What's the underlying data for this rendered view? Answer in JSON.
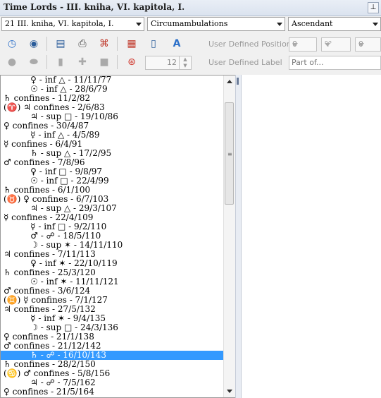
{
  "window": {
    "title": "Time Lords - III. kniha, VI. kapitola, I.",
    "pin_icon": "pin-icon"
  },
  "selectors": {
    "chart": "21 III. kniha, VI. kapitola, I.",
    "method": "Circumambulations",
    "reference": "Ascendant"
  },
  "toolbar": {
    "user_defined_position_label": "User Defined Position",
    "user_defined_label_label": "User Defined Label",
    "position_degree": "0",
    "position_sign": "♈",
    "position_minute": "0",
    "label_count": "12",
    "label_placeholder": "Part of..."
  },
  "list": {
    "items": [
      "     ♀ - inf △ - 11/11/77",
      "     ☉ - inf △ - 28/6/79",
      "♄ confines - 11/2/82",
      "(♈) ♃ confines - 2/6/83",
      "     ♃ - sup □ - 19/10/86",
      "♀ confines - 30/4/87",
      "     ☿ - inf △ - 4/5/89",
      "☿ confines - 6/4/91",
      "     ♄ - sup △ - 17/2/95",
      "♂ confines - 7/8/96",
      "     ♀ - inf □ - 9/8/97",
      "     ☉ - inf □ - 22/4/99",
      "♄ confines - 6/1/100",
      "(♉) ♀ confines - 6/7/103",
      "     ♃ - sup △ - 29/3/107",
      "☿ confines - 22/4/109",
      "     ☿ - inf □ - 9/2/110",
      "     ♂ - ☍ - 18/5/110",
      "     ☽ - sup ✶ - 14/11/110",
      "♃ confines - 7/11/113",
      "     ♀ - inf ✶ - 22/10/119",
      "♄ confines - 25/3/120",
      "     ☉ - inf ✶ - 11/11/121",
      "♂ confines - 3/6/124",
      "(♊) ☿ confines - 7/1/127",
      "♃ confines - 27/5/132",
      "     ☿ - inf ✶ - 9/4/135",
      "     ☽ - sup □ - 24/3/136",
      "♀ confines - 21/1/138",
      "♂ confines - 21/12/142",
      "     ♄ - ☍ - 16/10/143",
      "♄ confines - 28/2/150",
      "(♋) ♂ confines - 5/8/156",
      "     ♃ - ☍ - 7/5/162",
      "♀ confines - 21/5/164"
    ],
    "selected_index": 30
  }
}
